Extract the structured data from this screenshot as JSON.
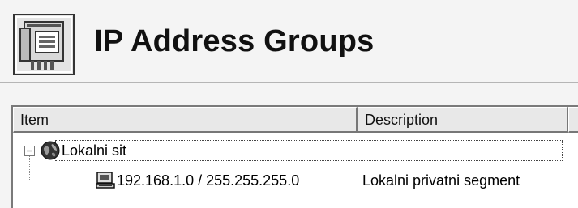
{
  "header": {
    "title": "IP Address Groups",
    "icon": "network-card-icon"
  },
  "list": {
    "columns": [
      {
        "label": "Item"
      },
      {
        "label": "Description"
      },
      {
        "label": ""
      }
    ],
    "rows": [
      {
        "label": "Lokalni sit",
        "description": "",
        "icon": "globe-icon",
        "expanded": true
      },
      {
        "label": "192.168.1.0 / 255.255.255.0",
        "description": "Lokalni privatni segment",
        "icon": "computer-icon"
      }
    ]
  },
  "colors": {
    "background": "#f4f4f4",
    "panel": "#ffffff"
  }
}
